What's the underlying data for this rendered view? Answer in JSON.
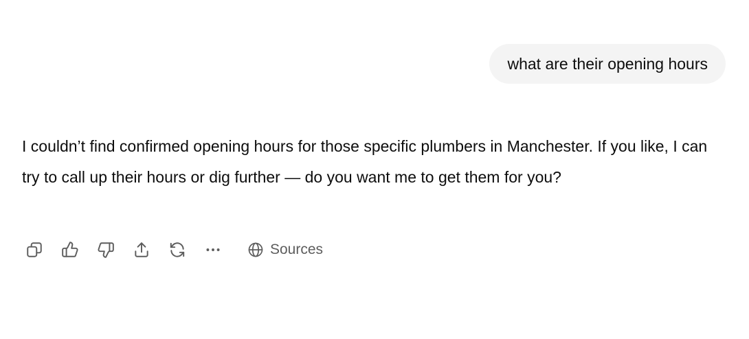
{
  "conversation": {
    "user_message": "what are their opening hours",
    "assistant_message": "I couldn’t find confirmed opening hours for those specific plumbers in Manchester. If you like, I can try to call up their hours or dig further — do you want me to get them for you?"
  },
  "actions": {
    "icons": [
      "copy-icon",
      "thumbs-up-icon",
      "thumbs-down-icon",
      "share-icon",
      "regenerate-icon",
      "more-icon"
    ],
    "sources_label": "Sources"
  },
  "colors": {
    "bubble_background": "#f4f4f4",
    "text": "#0d0d0d",
    "icon": "#5d5d5d"
  }
}
